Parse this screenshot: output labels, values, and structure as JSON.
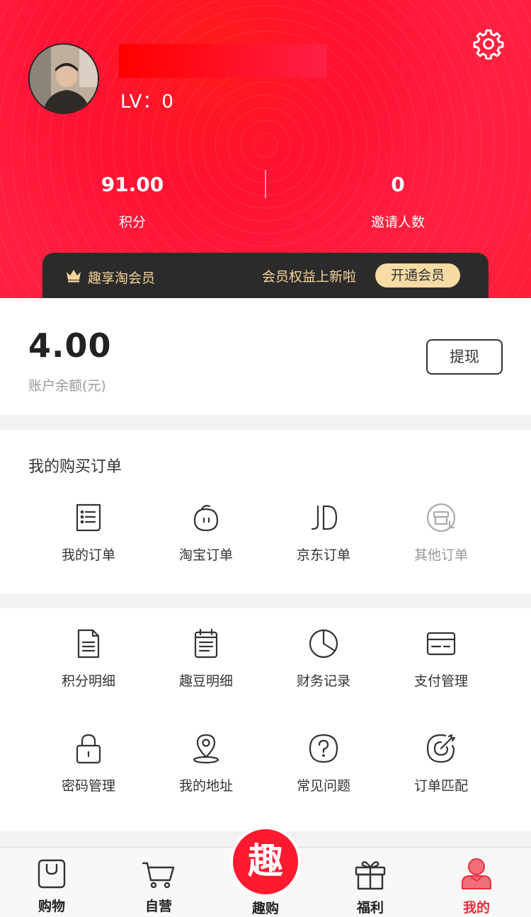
{
  "header": {
    "level_text": "LV：0",
    "stats": [
      {
        "value": "91.00",
        "label": "积分"
      },
      {
        "value": "0",
        "label": "邀请人数"
      }
    ],
    "member_bar": {
      "title": "趣享淘会员",
      "news": "会员权益上新啦",
      "button": "开通会员"
    }
  },
  "balance": {
    "amount": "4.00",
    "label": "账户余额(元)",
    "withdraw": "提现"
  },
  "orders": {
    "title": "我的购买订单",
    "items": [
      {
        "label": "我的订单",
        "icon": "order-list-icon"
      },
      {
        "label": "淘宝订单",
        "icon": "taobao-icon"
      },
      {
        "label": "京东订单",
        "icon": "jd-icon"
      },
      {
        "label": "其他订单",
        "icon": "other-orders-icon"
      }
    ]
  },
  "tools": {
    "items": [
      {
        "label": "积分明细",
        "icon": "document-icon"
      },
      {
        "label": "趣豆明细",
        "icon": "calendar-list-icon"
      },
      {
        "label": "财务记录",
        "icon": "pie-chart-icon"
      },
      {
        "label": "支付管理",
        "icon": "card-icon"
      },
      {
        "label": "密码管理",
        "icon": "lock-icon"
      },
      {
        "label": "我的地址",
        "icon": "location-pin-icon"
      },
      {
        "label": "常见问题",
        "icon": "question-bubble-icon"
      },
      {
        "label": "订单匹配",
        "icon": "target-icon"
      }
    ]
  },
  "tabbar": {
    "items": [
      {
        "label": "购物",
        "icon": "shopping-bag-icon"
      },
      {
        "label": "自营",
        "icon": "cart-icon"
      },
      {
        "label": "趣购",
        "icon": "qu-logo-icon",
        "glyph": "趣"
      },
      {
        "label": "福利",
        "icon": "gift-icon"
      },
      {
        "label": "我的",
        "icon": "user-icon",
        "active": true
      }
    ]
  },
  "colors": {
    "brand_red": "#ff1a2f",
    "gold": "#f4d49a",
    "active_tab": "#e8303c"
  }
}
